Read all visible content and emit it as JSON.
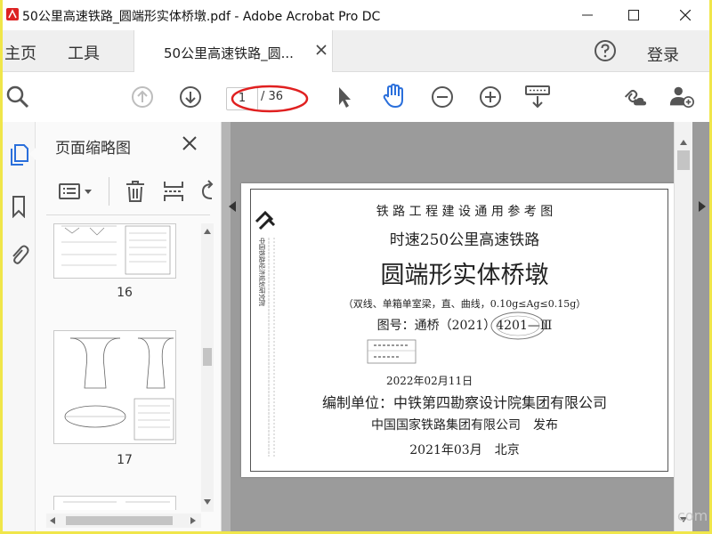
{
  "window": {
    "title": "50公里高速铁路_圆端形实体桥墩.pdf - Adobe Acrobat Pro DC"
  },
  "tabs": {
    "home": "主页",
    "tools": "工具",
    "document": "50公里高速铁路_圆...",
    "login": "登录"
  },
  "toolbar": {
    "page_current": "1",
    "page_total": "/ 36"
  },
  "thumbnails": {
    "title": "页面缩略图",
    "pages": [
      {
        "label": "16"
      },
      {
        "label": "17"
      }
    ]
  },
  "document": {
    "line1": "铁 路 工 程 建 设 通 用 参 考 图",
    "line2": "时速250公里高速铁路",
    "line3": "圆端形实体桥墩",
    "line4": "（双线、单箱单室梁，直、曲线，0.10g≤Ag≤0.15g）",
    "line5": "图号：通桥（2021）4201—Ⅲ",
    "date_stamp": "2022年02月11日",
    "line6": "编制单位：中铁第四勘察设计院集团有限公司",
    "line7": "中国国家铁路集团有限公司　发布",
    "line8": "2021年03月　北京",
    "side_text": "中国铁路经济规划研究院"
  },
  "watermark": "com",
  "colors": {
    "accent_blue": "#2a6fdb",
    "annotation_red": "#e02020"
  }
}
